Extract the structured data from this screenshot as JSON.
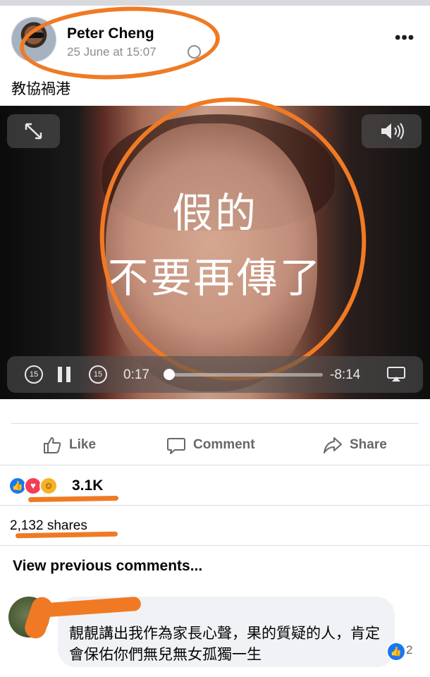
{
  "post": {
    "author": "Peter Cheng",
    "timestamp": "25 June at 15:07",
    "more_label": "•••",
    "text": "教協禍港"
  },
  "video": {
    "overlay_line1": "假的",
    "overlay_line2": "不要再傳了",
    "skip_back_label": "15",
    "skip_fwd_label": "15",
    "current_time": "0:17",
    "remaining_time": "-8:14",
    "progress_fraction": 0.02
  },
  "actions": {
    "like": "Like",
    "comment": "Comment",
    "share": "Share"
  },
  "reactions": {
    "count": "3.1K",
    "shares": "2,132 shares"
  },
  "comments": {
    "view_previous": "View previous comments...",
    "items": [
      {
        "author": "",
        "text": "靚靚講出我作為家長心聲，果的質疑的人，肯定會保佑你們無兒無女孤獨一生",
        "reaction_count": "2"
      }
    ]
  },
  "colors": {
    "annotation": "#f07a24",
    "like_blue": "#1877f2"
  }
}
